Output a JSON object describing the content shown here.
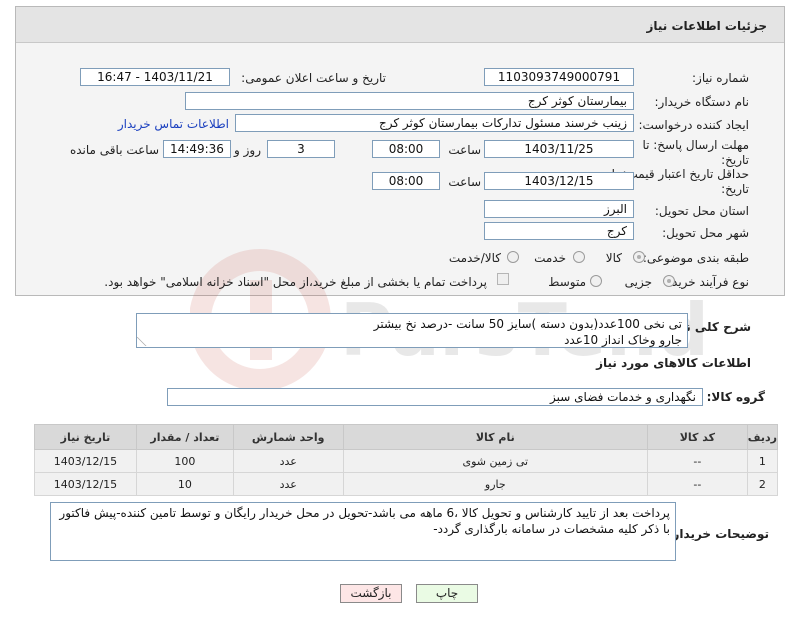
{
  "panel": {
    "title": "جزئیات اطلاعات نیاز"
  },
  "fields": {
    "need_number_label": "شماره نیاز:",
    "need_number": "1103093749000791",
    "announce_label": "تاریخ و ساعت اعلان عمومی:",
    "announce_value": "1403/11/21 - 16:47",
    "buyer_org_label": "نام دستگاه خریدار:",
    "buyer_org": "بیمارستان کوثر کرج",
    "creator_label": "ایجاد کننده درخواست:",
    "creator": "زینب خرسند مسئول تدارکات بیمارستان کوثر کرج",
    "contact_link": "اطلاعات تماس خریدار",
    "reply_deadline_label": "مهلت ارسال پاسخ: تا تاریخ:",
    "reply_date": "1403/11/25",
    "time_label": "ساعت",
    "reply_time": "08:00",
    "days_value": "3",
    "days_label": "روز و",
    "remaining_time": "14:49:36",
    "remaining_label": "ساعت باقی مانده",
    "price_validity_label": "حداقل تاریخ اعتبار قیمت: تا تاریخ:",
    "price_date": "1403/12/15",
    "price_time_label": "ساعت",
    "price_time": "08:00",
    "province_label": "استان محل تحویل:",
    "province": "البرز",
    "city_label": "شهر محل تحویل:",
    "city": "کرج",
    "category_label": "طبقه بندی موضوعی:",
    "category_options": [
      "کالا",
      "خدمت",
      "کالا/خدمت"
    ],
    "process_label": "نوع فرآیند خرید :",
    "process_options": [
      "جزیی",
      "متوسط"
    ],
    "payment_note": "پرداخت تمام یا بخشی از مبلغ خرید،از محل \"اسناد خزانه اسلامی\" خواهد بود."
  },
  "description": {
    "label": "شرح کلی نیاز:",
    "text": "تی نخی 100عدد(بدون دسته )سایز 50 سانت -درصد نخ بیشتر\nجارو وخاک انداز 10عدد"
  },
  "goods": {
    "section_title": "اطلاعات کالاهای مورد نیاز",
    "group_label": "گروه کالا:",
    "group_value": "نگهداری و خدمات فضای سبز",
    "columns": [
      "ردیف",
      "کد کالا",
      "نام کالا",
      "واحد شمارش",
      "تعداد / مقدار",
      "تاریخ نیاز"
    ],
    "rows": [
      {
        "row": "1",
        "code": "--",
        "name": "تی زمین شوی",
        "unit": "عدد",
        "qty": "100",
        "date": "1403/12/15"
      },
      {
        "row": "2",
        "code": "--",
        "name": "جارو",
        "unit": "عدد",
        "qty": "10",
        "date": "1403/12/15"
      }
    ]
  },
  "buyer_notes": {
    "label": "توضیحات خریدار:",
    "text": "پرداخت بعد از تایید کارشناس و تحویل کالا ،6 ماهه می باشد-تحویل در محل خریدار رایگان و توسط تامین کننده-پیش فاکتور با ذکر کلیه مشخصات در سامانه بارگذاری گردد-"
  },
  "buttons": {
    "print": "چاپ",
    "back": "بازگشت"
  },
  "colors": {
    "print_bg": "#eafbe4",
    "back_bg": "#fde6e6",
    "link": "#1a3fbf"
  }
}
